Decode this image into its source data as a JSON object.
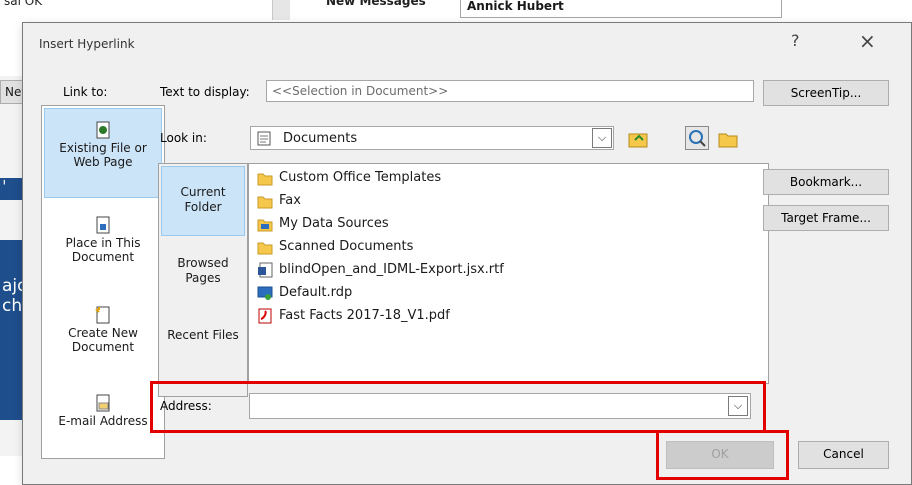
{
  "background": {
    "top_fragment": "sal   OK",
    "new_messages": "New Messages",
    "contact": "Annick Hubert",
    "ribbon_btn": "Nev",
    "left_text_1": "ajo",
    "left_text_2": "cho"
  },
  "dialog": {
    "title": "Insert Hyperlink",
    "help_glyph": "?",
    "close_glyph": "×",
    "link_to_label": "Link to:",
    "text_to_display_label": "Text to display:",
    "text_to_display_value": "<<Selection in Document>>",
    "screentip_label": "ScreenTip...",
    "look_in_label": "Look in:",
    "look_in_value": "Documents",
    "link_items": [
      {
        "label": "Existing File or Web Page"
      },
      {
        "label": "Place in This Document"
      },
      {
        "label": "Create New Document"
      },
      {
        "label": "E-mail Address"
      }
    ],
    "nav_items": [
      {
        "label": "Current Folder"
      },
      {
        "label": "Browsed Pages"
      },
      {
        "label": "Recent Files"
      }
    ],
    "files": [
      {
        "name": "Custom Office Templates",
        "icon": "folder-icon"
      },
      {
        "name": "Fax",
        "icon": "folder-icon"
      },
      {
        "name": "My Data Sources",
        "icon": "data-sources-folder-icon"
      },
      {
        "name": "Scanned Documents",
        "icon": "folder-icon"
      },
      {
        "name": "blindOpen_and_IDML-Export.jsx.rtf",
        "icon": "word-document-icon"
      },
      {
        "name": "Default.rdp",
        "icon": "remote-desktop-icon"
      },
      {
        "name": "Fast Facts 2017-18_V1.pdf",
        "icon": "pdf-icon"
      }
    ],
    "bookmark_label": "Bookmark...",
    "target_frame_label": "Target Frame...",
    "address_label": "Address:",
    "address_value": "",
    "ok_label": "OK",
    "cancel_label": "Cancel",
    "colors": {
      "highlight_red": "#e30000",
      "selection_blue": "#cce4f7",
      "dialog_bg": "#f0f0f0"
    }
  }
}
